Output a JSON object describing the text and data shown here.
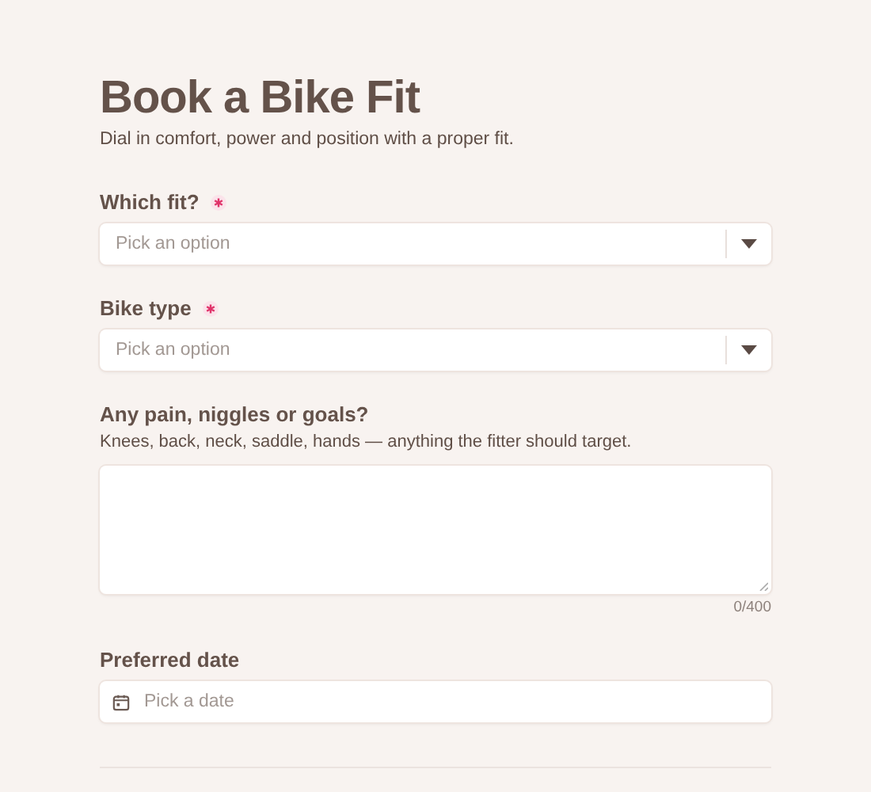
{
  "title": "Book a Bike Fit",
  "subtitle": "Dial in comfort, power and position with a proper fit.",
  "fields": [
    {
      "kind": "select",
      "label": "Which fit?",
      "required": true,
      "placeholder": "Pick an option"
    },
    {
      "kind": "select",
      "label": "Bike type",
      "required": true,
      "placeholder": "Pick an option"
    },
    {
      "kind": "textarea",
      "label": "Any pain, niggles or goals?",
      "hint": "Knees, back, neck, saddle, hands — anything the fitter should target.",
      "counter": "0/400"
    },
    {
      "kind": "date",
      "label": "Preferred date",
      "placeholder": "Pick a date"
    }
  ]
}
